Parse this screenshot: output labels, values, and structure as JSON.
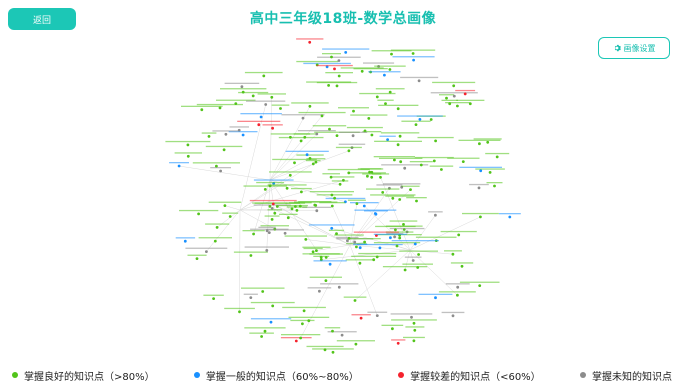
{
  "header": {
    "back_label": "返回",
    "title": "高中三年级18班-数学总画像",
    "settings_label": "画像设置",
    "settings_icon": "gear-icon"
  },
  "legend": [
    {
      "label": "掌握良好的知识点（>80%）",
      "color": "#52c41a"
    },
    {
      "label": "掌握一般的知识点（60%~80%）",
      "color": "#1890ff"
    },
    {
      "label": "掌握较差的知识点（<60%）",
      "color": "#f5222d"
    },
    {
      "label": "掌握未知的知识点",
      "color": "#8c8c8c"
    }
  ],
  "colors": {
    "accent": "#1cc7b6",
    "good": "#52c41a",
    "fair": "#1890ff",
    "poor": "#f5222d",
    "unknown": "#8c8c8c",
    "edge": "#d9d9d9"
  }
}
